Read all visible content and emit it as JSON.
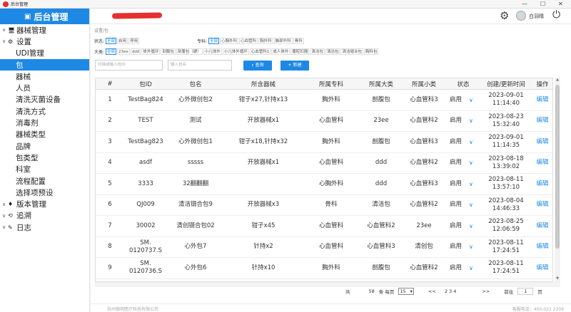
{
  "window": {
    "title": "后台管理",
    "minimize": "—",
    "maximize": "☐",
    "close": "✕"
  },
  "sidebar": {
    "brand": "后台管理",
    "menu": [
      {
        "label": "器械管理",
        "chev": "∨",
        "icon": "🖥",
        "level": "top",
        "selected": false
      },
      {
        "label": "设置",
        "chev": "∨",
        "icon": "⚙",
        "level": "top",
        "selected": false
      },
      {
        "label": "UDI管理",
        "level": "sub",
        "selected": false
      },
      {
        "label": "包",
        "level": "sub",
        "selected": true
      },
      {
        "label": "器械",
        "level": "sub",
        "selected": false
      },
      {
        "label": "人员",
        "level": "sub",
        "selected": false
      },
      {
        "label": "清洗灭菌设备",
        "level": "sub",
        "selected": false
      },
      {
        "label": "清洗方式",
        "level": "sub",
        "selected": false
      },
      {
        "label": "消毒剂",
        "level": "sub",
        "selected": false
      },
      {
        "label": "器械类型",
        "level": "sub",
        "selected": false
      },
      {
        "label": "品牌",
        "level": "sub",
        "selected": false
      },
      {
        "label": "包类型",
        "level": "sub",
        "selected": false
      },
      {
        "label": "科室",
        "level": "sub",
        "selected": false
      },
      {
        "label": "流程配置",
        "level": "sub",
        "selected": false
      },
      {
        "label": "选择项预设",
        "level": "sub",
        "selected": false
      },
      {
        "label": "版本管理",
        "chev": "∨",
        "icon": "♦",
        "level": "top",
        "selected": false
      },
      {
        "label": "追溯",
        "chev": "∨",
        "icon": "⟲",
        "level": "top",
        "selected": false
      },
      {
        "label": "日志",
        "chev": "∨",
        "icon": "✎",
        "level": "top",
        "selected": false
      }
    ]
  },
  "header": {
    "user": "白羽晴"
  },
  "breadcrumb": "设置/包",
  "filters": {
    "status_label": "状态:",
    "status": [
      {
        "label": "全部",
        "on": true
      },
      {
        "label": "启用",
        "on": false
      },
      {
        "label": "停用",
        "on": false
      }
    ],
    "specialty_label": "专科:",
    "specialty": [
      {
        "label": "全部",
        "on": true
      },
      {
        "label": "心胸外科",
        "on": false
      },
      {
        "label": "心血管科",
        "on": false
      },
      {
        "label": "胸外科",
        "on": false
      },
      {
        "label": "脑部外科",
        "on": false
      },
      {
        "label": "骨科",
        "on": false
      }
    ],
    "category_label": "大类:",
    "category": [
      {
        "label": "全部",
        "on": true
      },
      {
        "label": "23ee",
        "on": false
      },
      {
        "label": "ddd",
        "on": false
      },
      {
        "label": "体外循环",
        "on": false
      },
      {
        "label": "剖腹包",
        "on": false
      },
      {
        "label": "剖腹包（硬）",
        "on": false
      },
      {
        "label": "小儿体外",
        "on": false
      },
      {
        "label": "小儿体外循环",
        "on": false
      },
      {
        "label": "心血管科1",
        "on": false
      },
      {
        "label": "成人体外",
        "on": false
      },
      {
        "label": "腹腔扣器",
        "on": false
      },
      {
        "label": "清洁包",
        "on": false
      },
      {
        "label": "清洁包",
        "on": false
      },
      {
        "label": "清洁缝合包",
        "on": false
      },
      {
        "label": "胸科包",
        "on": false
      }
    ]
  },
  "search": {
    "id_placeholder": "扫描或输入包ID",
    "name_placeholder": "输入包名",
    "query_label": "查询",
    "new_label": "新建"
  },
  "table": {
    "headers": [
      "#",
      "包ID",
      "包名",
      "所含器械",
      "所属专科",
      "所属大类",
      "所属小类",
      "状态",
      "创建/更新时间",
      "操作"
    ],
    "rows": [
      [
        "1",
        "TestBag824",
        "心外微创包2",
        "钳子x27,针持x13",
        "胸外科",
        "剖腹包",
        "心血管科3",
        "启用",
        "2023-09-01\n11:14:40",
        "编辑"
      ],
      [
        "2",
        "TEST",
        "测试",
        "开放器械x1",
        "心血管科",
        "23ee",
        "心血管科2",
        "启用",
        "2023-08-23\n15:32:40",
        "编辑"
      ],
      [
        "3",
        "TestBag823",
        "心外微创包1",
        "钳子x18,针持x32",
        "胸外科",
        "剖腹包",
        "心血管科3",
        "启用",
        "2023-09-01\n11:14:35",
        "编辑"
      ],
      [
        "4",
        "asdf",
        "sssss",
        "开放器械x1",
        "心血管科",
        "ddd",
        "心血管科2",
        "启用",
        "2023-08-18\n13:39:02",
        "编辑"
      ],
      [
        "5",
        "3333",
        "32翻翻翻",
        "",
        "心胸外科",
        "ddd",
        "心血管科3",
        "启用",
        "2023-08-11\n13:57:10",
        "编辑"
      ],
      [
        "6",
        "QJ009",
        "清洁镊合包9",
        "开放器械x3",
        "骨科",
        "清洁包",
        "心血管科2",
        "启用",
        "2023-08-04\n14:46:33",
        "编辑"
      ],
      [
        "7",
        "30002",
        "清创镊合包02",
        "钳子x45",
        "心血管科",
        "心血管科2",
        "23ee",
        "启用",
        "2023-08-25\n12:06:59",
        "编辑"
      ],
      [
        "8",
        "SM.\n0120737.S",
        "心外包7",
        "针持x2",
        "心血管科",
        "心血管科3",
        "清创包",
        "启用",
        "2023-08-11\n17:24:51",
        "编辑"
      ],
      [
        "9",
        "SM.\n0120736.S",
        "心外包6",
        "针持x10",
        "胸外科",
        "剖腹包",
        "心血管科2",
        "启用",
        "2023-08-11\n17:24:51",
        "编辑"
      ]
    ]
  },
  "pager": {
    "total_label": "共",
    "total": "58",
    "per_page_label": "条 每页",
    "per_page": "15",
    "prev": "<<",
    "pages": "2  3  4",
    "next": ">>",
    "goto_label": "前往",
    "goto_page": "1",
    "page_unit": "页"
  },
  "footer": {
    "company": "苏州微明医疗科技有限公司",
    "hotline": "客服电话：400-021 2209"
  }
}
